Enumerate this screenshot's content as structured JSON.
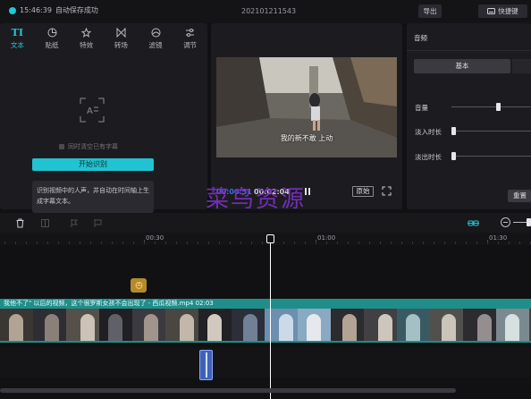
{
  "topbar": {
    "status_time": "15:46:39",
    "status_text": "自动保存成功",
    "project_title": "202101211543",
    "export_label": "导出",
    "shortcut_label": "快捷键"
  },
  "left_panel": {
    "tabs": [
      {
        "icon": "text-icon",
        "label": "文本",
        "active": true
      },
      {
        "icon": "sticker-icon",
        "label": "贴纸",
        "active": false
      },
      {
        "icon": "effects-icon",
        "label": "特效",
        "active": false
      },
      {
        "icon": "transition-icon",
        "label": "转场",
        "active": false
      },
      {
        "icon": "filter-icon",
        "label": "滤镜",
        "active": false
      },
      {
        "icon": "adjust-icon",
        "label": "调节",
        "active": false
      }
    ],
    "sync_clear_label": "同时清空已有字幕",
    "start_button": "开始识别",
    "info_text": "识别视频中的人声，并自动在时间轴上生成字幕文本。"
  },
  "player": {
    "subtitle_text": "我的新不敢 上动",
    "current_time": "00:00:51",
    "total_time": "00:02:04",
    "ratio_label": "原始"
  },
  "watermark": "菜鸟资源",
  "right_panel": {
    "title": "音频",
    "tab_basic": "基本",
    "volume_label": "音量",
    "volume_level": 0.6,
    "fade_in_label": "淡入时长",
    "fade_out_label": "淡出时长",
    "reset_label": "重置"
  },
  "timeline": {
    "ruler_labels": [
      "00:30",
      "01:00",
      "01:30"
    ],
    "clip_label": "我他不了\" 以后的视频，这个很罗斯女孩不会出现了 - 西瓜视频.mp4   02:03"
  },
  "colors": {
    "accent": "#21c7d6",
    "clip": "#1f8e8a",
    "time_current": "#3b6fe0",
    "watermark": "#7b2fc0"
  }
}
